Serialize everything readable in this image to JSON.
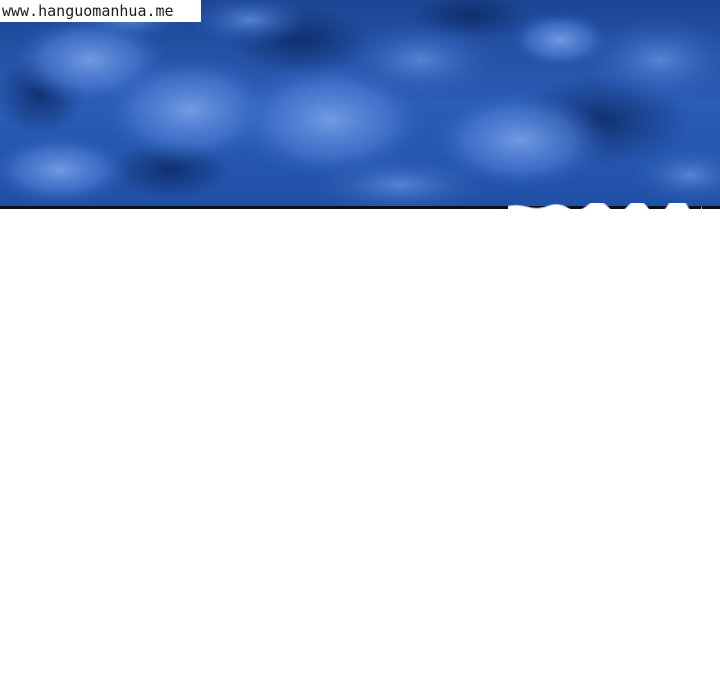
{
  "watermark": {
    "text": "www.hanguomanhua.me"
  },
  "colors": {
    "sky_light": "#4f7fd6",
    "sky_mid": "#2a5cb5",
    "sky_dark": "#0f2f6e",
    "cloud_highlight": "#6f9be6",
    "border": "#0b0f1a",
    "background": "#ffffff"
  }
}
